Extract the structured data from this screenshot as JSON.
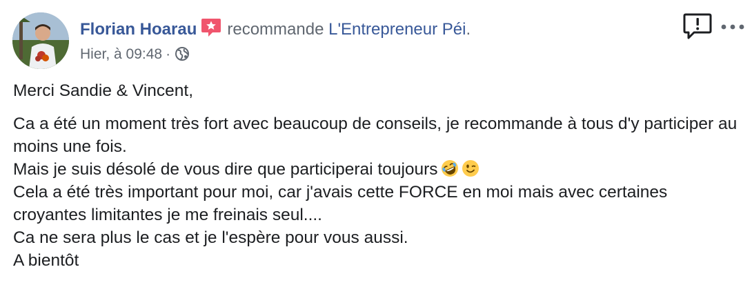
{
  "post": {
    "author_name": "Florian Hoarau",
    "action_text": "recommande",
    "page_name": "L'Entrepreneur Péi",
    "period": ".",
    "timestamp": "Hier, à 09:48",
    "separator": "·",
    "privacy_icon": "globe-icon",
    "recommend_icon": "star-badge-icon",
    "report_icon": "report-bubble-icon",
    "more_icon": "more-dots-icon",
    "body": {
      "greeting": "Merci Sandie & Vincent,",
      "paragraph_lines": [
        "Ca a été un moment très fort avec beaucoup de conseils, je recommande à tous d'y participer au moins une fois.",
        "Mais je suis désolé de vous dire que participerai toujours",
        "Cela a été très important pour moi, car j'avais cette FORCE en moi mais avec certaines croyantes limitantes je me freinais seul....",
        "Ca ne sera plus le cas et je l'espère pour vous aussi.",
        "A bientôt"
      ],
      "emojis": [
        "rolling-laughing-emoji",
        "winking-emoji"
      ]
    }
  },
  "colors": {
    "link_blue": "#385898",
    "meta_gray": "#606770",
    "text": "#1c1e21",
    "recommend_pink": "#f0556d",
    "icon_dark": "#1c1e21"
  }
}
